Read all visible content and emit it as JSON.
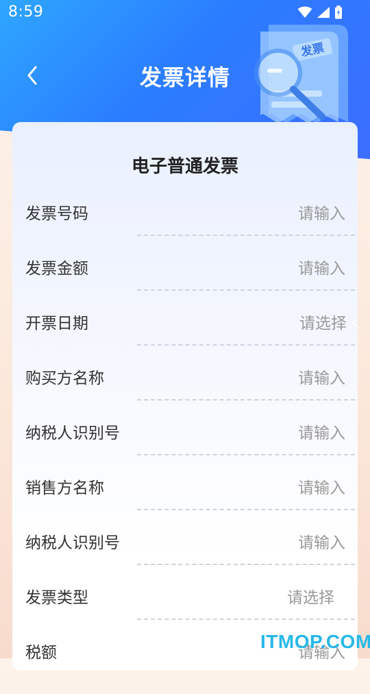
{
  "status_bar": {
    "time": "8:59"
  },
  "header": {
    "title": "发票详情"
  },
  "illustration": {
    "stamp_text": "发票"
  },
  "form": {
    "heading": "电子普通发票",
    "fields": [
      {
        "label": "发票号码",
        "value": "请输入"
      },
      {
        "label": "发票金额",
        "value": "请输入"
      },
      {
        "label": "开票日期",
        "value": "请选择"
      },
      {
        "label": "购买方名称",
        "value": "请输入"
      },
      {
        "label": "纳税人识别号",
        "value": "请输入"
      },
      {
        "label": "销售方名称",
        "value": "请输入"
      },
      {
        "label": "纳税人识别号",
        "value": "请输入"
      },
      {
        "label": "发票类型",
        "value": "请选择"
      },
      {
        "label": "税额",
        "value": "请输入"
      }
    ]
  },
  "watermark": {
    "text": "ITMOP.COM"
  },
  "colors": {
    "header_start": "#2ea6ff",
    "header_end": "#3c6dff",
    "placeholder": "#999999",
    "label": "#333333"
  }
}
